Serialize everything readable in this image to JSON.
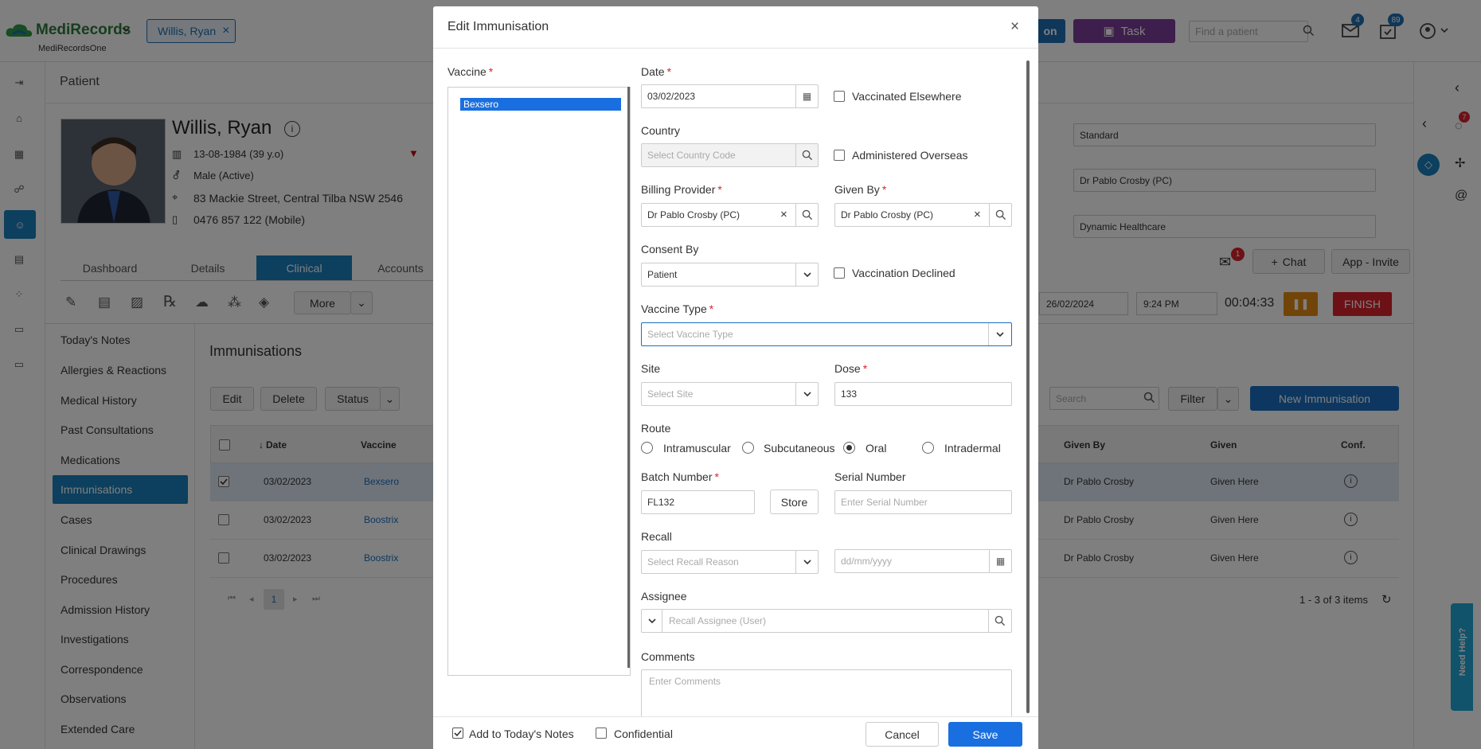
{
  "app": {
    "brand": "MediRecords",
    "sub": "MediRecordsOne",
    "patient_chip": "Willis, Ryan",
    "btn_blue_partial": "on",
    "task_label": "Task",
    "find_patient_placeholder": "Find a patient",
    "mail_badge": "4",
    "tasks_badge": "89"
  },
  "patient": {
    "section_title": "Patient",
    "name": "Willis, Ryan",
    "dob": "13-08-1984 (39 y.o)",
    "gender": "Male (Active)",
    "address": "83 Mackie Street, Central Tilba NSW 2546",
    "phone": "0476 857 122 (Mobile)"
  },
  "right_panel": {
    "fee": "Standard",
    "provider": "Dr Pablo Crosby (PC)",
    "clinic": "Dynamic Healthcare",
    "chat": "Chat",
    "app_invite": "App - Invite",
    "date": "26/02/2024",
    "time": "9:24 PM",
    "timer": "00:04:33",
    "finish": "FINISH",
    "msg_badge": "1",
    "right_badge": "7",
    "need_help": "Need Help?"
  },
  "tabs": [
    "Dashboard",
    "Details",
    "Clinical",
    "Accounts"
  ],
  "toolbar": {
    "more": "More"
  },
  "sidebar": [
    "Today's Notes",
    "Allergies & Reactions",
    "Medical History",
    "Past Consultations",
    "Medications",
    "Immunisations",
    "Cases",
    "Clinical Drawings",
    "Procedures",
    "Admission History",
    "Investigations",
    "Correspondence",
    "Observations",
    "Extended Care"
  ],
  "immunisations": {
    "title": "Immunisations",
    "edit": "Edit",
    "delete": "Delete",
    "status": "Status",
    "search_placeholder": "Search",
    "filter": "Filter",
    "new": "New Immunisation",
    "col_date": "Date",
    "col_vaccine": "Vaccine",
    "col_given_by": "Given By",
    "col_given": "Given",
    "col_conf": "Conf.",
    "rows": [
      {
        "date": "03/02/2023",
        "vaccine": "Bexsero",
        "given_by": "Dr Pablo Crosby",
        "given": "Given Here"
      },
      {
        "date": "03/02/2023",
        "vaccine": "Boostrix",
        "given_by": "Dr Pablo Crosby",
        "given": "Given Here"
      },
      {
        "date": "03/02/2023",
        "vaccine": "Boostrix",
        "given_by": "Dr Pablo Crosby",
        "given": "Given Here"
      }
    ],
    "page": "1",
    "items": "1 - 3 of 3 items"
  },
  "modal": {
    "title": "Edit Immunisation",
    "vaccine_label": "Vaccine",
    "vaccine_selected": "Bexsero",
    "date_label": "Date",
    "date_value": "03/02/2023",
    "vacc_elsewhere": "Vaccinated Elsewhere",
    "country_label": "Country",
    "country_placeholder": "Select Country Code",
    "admin_overseas": "Administered Overseas",
    "billing_label": "Billing Provider",
    "billing_value": "Dr Pablo Crosby (PC)",
    "given_by_label": "Given By",
    "given_by_value": "Dr Pablo Crosby (PC)",
    "consent_label": "Consent By",
    "consent_value": "Patient",
    "declined": "Vaccination Declined",
    "type_label": "Vaccine Type",
    "type_placeholder": "Select Vaccine Type",
    "site_label": "Site",
    "site_placeholder": "Select Site",
    "dose_label": "Dose",
    "dose_value": "133",
    "route_label": "Route",
    "routes": [
      "Intramuscular",
      "Subcutaneous",
      "Oral",
      "Intradermal"
    ],
    "batch_label": "Batch Number",
    "batch_value": "FL132",
    "store": "Store",
    "serial_label": "Serial Number",
    "serial_placeholder": "Enter Serial Number",
    "recall_label": "Recall",
    "recall_placeholder": "Select Recall Reason",
    "recall_date_placeholder": "dd/mm/yyyy",
    "assignee_label": "Assignee",
    "assignee_placeholder": "Recall Assignee (User)",
    "comments_label": "Comments",
    "comments_placeholder": "Enter Comments",
    "add_notes": "Add to Today's Notes",
    "confidential": "Confidential",
    "cancel": "Cancel",
    "save": "Save"
  }
}
